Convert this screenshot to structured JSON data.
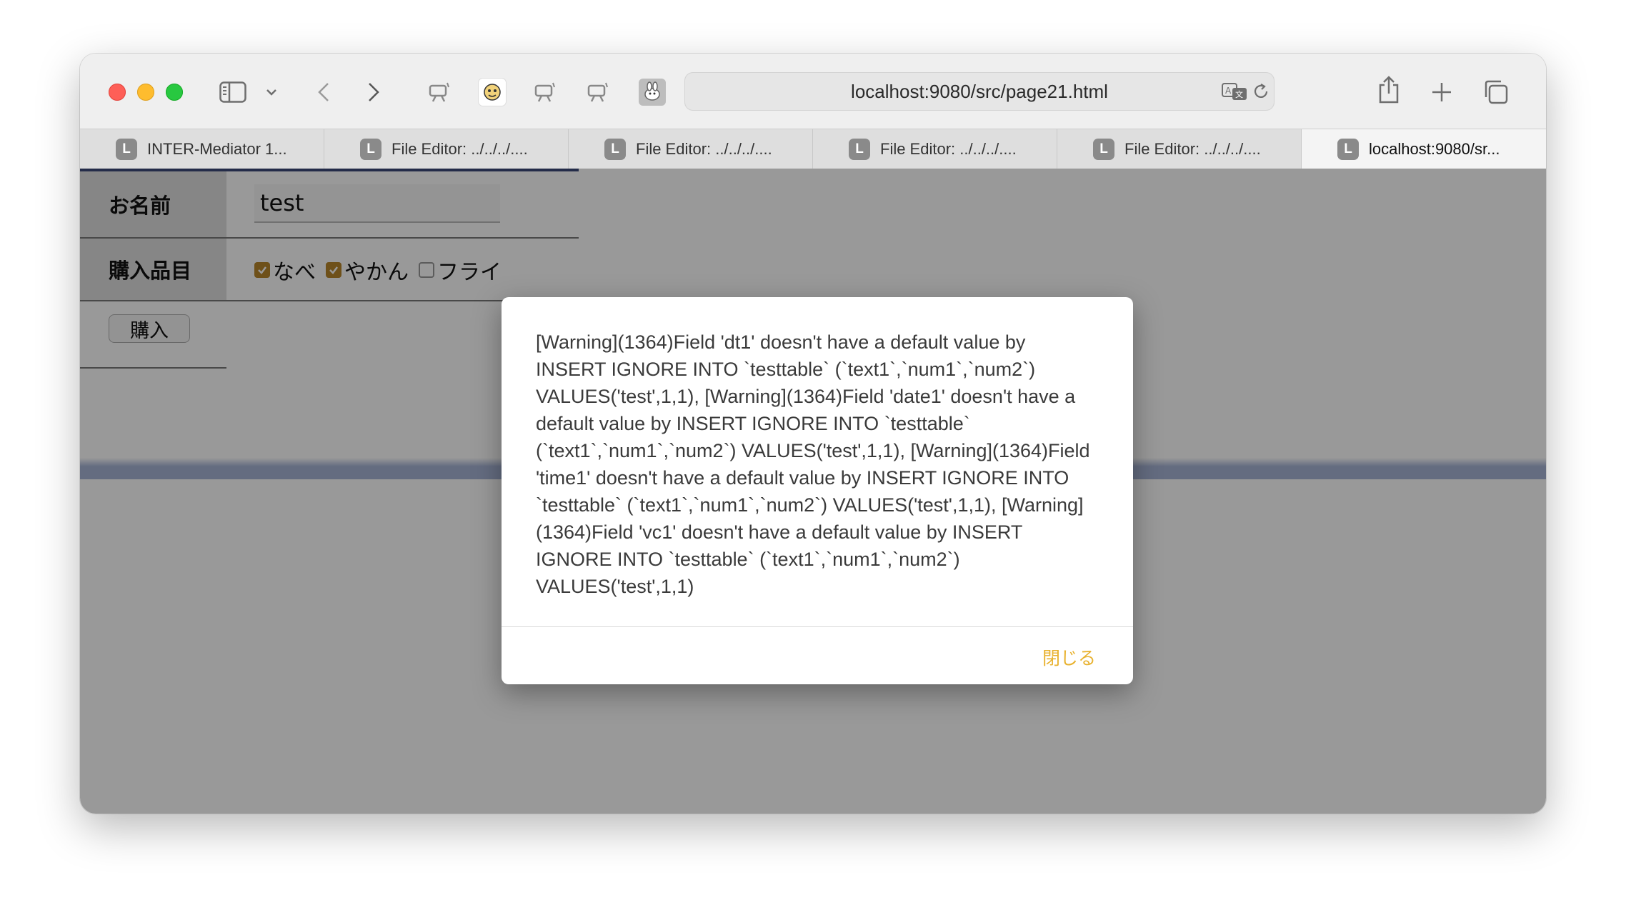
{
  "browser": {
    "url": "localhost:9080/src/page21.html",
    "tabs": [
      {
        "favicon": "L",
        "label": "INTER-Mediator 1..."
      },
      {
        "favicon": "L",
        "label": "File Editor: ../../../...."
      },
      {
        "favicon": "L",
        "label": "File Editor: ../../../...."
      },
      {
        "favicon": "L",
        "label": "File Editor: ../../../...."
      },
      {
        "favicon": "L",
        "label": "File Editor: ../../../...."
      },
      {
        "favicon": "L",
        "label": "localhost:9080/sr..."
      }
    ],
    "active_tab_index": 5
  },
  "form": {
    "name_label": "お名前",
    "name_value": "test",
    "items_label": "購入品目",
    "items": [
      {
        "label": "なべ",
        "checked": true
      },
      {
        "label": "やかん",
        "checked": true
      },
      {
        "label": "フライ",
        "checked": false
      }
    ],
    "buy_label": "購入"
  },
  "dialog": {
    "message": "[Warning](1364)Field 'dt1' doesn't have a default value by INSERT IGNORE INTO `testtable` (`text1`,`num1`,`num2`) VALUES('test',1,1), [Warning](1364)Field 'date1' doesn't have a default value by INSERT IGNORE INTO `testtable` (`text1`,`num1`,`num2`) VALUES('test',1,1), [Warning](1364)Field 'time1' doesn't have a default value by INSERT IGNORE INTO `testtable` (`text1`,`num1`,`num2`) VALUES('test',1,1), [Warning](1364)Field 'vc1' doesn't have a default value by INSERT IGNORE INTO `testtable` (`text1`,`num1`,`num2`) VALUES('test',1,1)",
    "close_label": "閉じる"
  },
  "colors": {
    "checkbox_checked": "#b8862b",
    "dialog_button": "#e8b230",
    "tab_underline": "#3d4a7a"
  }
}
